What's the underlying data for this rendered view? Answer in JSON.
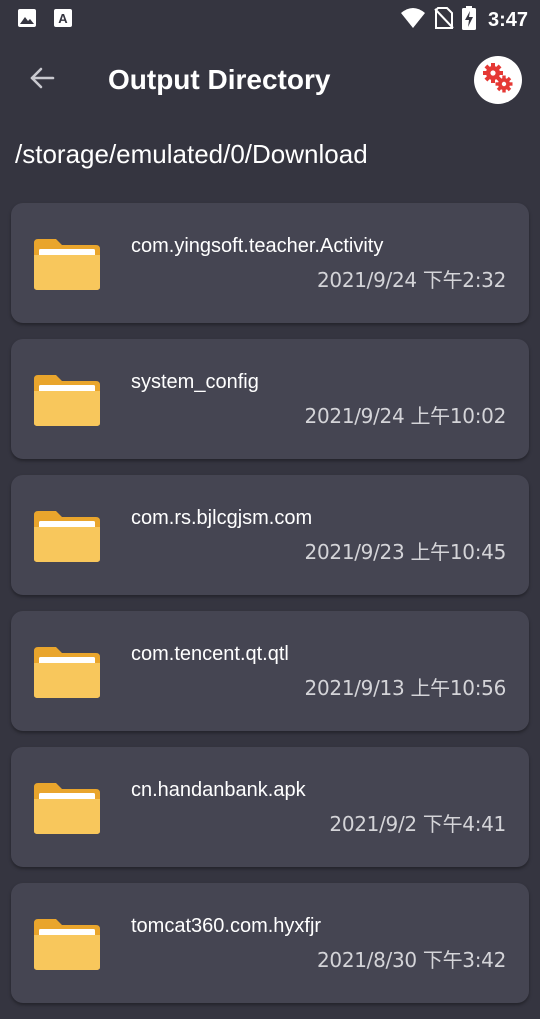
{
  "status_bar": {
    "time": "3:47",
    "icons": [
      "image-icon",
      "font-icon",
      "wifi-icon",
      "no-sim-icon",
      "battery-charging-icon"
    ]
  },
  "header": {
    "title": "Output Directory",
    "back_icon": "arrow-left-icon",
    "settings_icon": "gears-icon"
  },
  "path": "/storage/emulated/0/Download",
  "folders": [
    {
      "name": "com.yingsoft.teacher.Activity",
      "date": "2021/9/24 下午2:32"
    },
    {
      "name": "system_config",
      "date": "2021/9/24 上午10:02"
    },
    {
      "name": "com.rs.bjlcgjsm.com",
      "date": "2021/9/23 上午10:45"
    },
    {
      "name": "com.tencent.qt.qtl",
      "date": "2021/9/13 上午10:56"
    },
    {
      "name": "cn.handanbank.apk",
      "date": "2021/9/2 下午4:41"
    },
    {
      "name": "tomcat360.com.hyxfjr",
      "date": "2021/8/30 下午3:42"
    }
  ],
  "colors": {
    "background": "#353540",
    "card": "#454552",
    "folder_yellow": "#f7c75a",
    "gear_red": "#e53935"
  }
}
